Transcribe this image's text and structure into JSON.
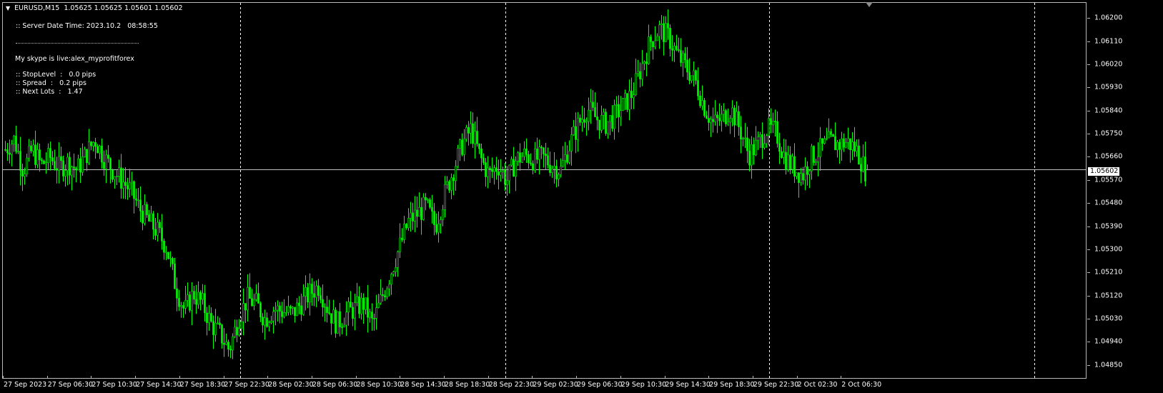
{
  "header": {
    "symbol": "EURUSD,M15",
    "ohlc": "1.05625 1.05625 1.05601 1.05602"
  },
  "info": {
    "server_time": ":: Server Date Time: 2023.10.2   08:58:55",
    "skype": "My skype is live:alex_myprofitforex",
    "stop_level": ":: StopLevel  :   0.0 pips",
    "spread": ":: Spread  :   0.2 pips",
    "next_lots": ":: Next Lots  :   1.47"
  },
  "colors": {
    "background": "#000000",
    "candles": "#00ff00",
    "grid": "#ffffff",
    "bid_line": "#c0c0c0"
  },
  "current_price": "1.05602",
  "chart_data": {
    "type": "candlestick",
    "symbol": "EURUSD",
    "timeframe": "M15",
    "ylim": [
      1.0481,
      1.0624
    ],
    "price_ticks": [
      "1.06200",
      "1.06110",
      "1.06020",
      "1.05930",
      "1.05840",
      "1.05750",
      "1.05660",
      "1.05570",
      "1.05480",
      "1.05390",
      "1.05300",
      "1.05210",
      "1.05120",
      "1.05030",
      "1.04940",
      "1.04850"
    ],
    "time_ticks": [
      "27 Sep 2023",
      "27 Sep 06:30",
      "27 Sep 10:30",
      "27 Sep 14:30",
      "27 Sep 18:30",
      "27 Sep 22:30",
      "28 Sep 02:30",
      "28 Sep 06:30",
      "28 Sep 10:30",
      "28 Sep 14:30",
      "28 Sep 18:30",
      "28 Sep 22:30",
      "29 Sep 02:30",
      "29 Sep 06:30",
      "29 Sep 10:30",
      "29 Sep 14:30",
      "29 Sep 18:30",
      "29 Sep 22:30",
      "2 Oct 02:30",
      "2 Oct 06:30"
    ],
    "period_separators": [
      "27 Sep 23:00",
      "28 Sep 23:00",
      "29 Sep 23:00",
      "2 Oct 23:00"
    ],
    "last_price": 1.05602,
    "price_path": [
      1.0568,
      1.0572,
      1.056,
      1.0568,
      1.0562,
      1.0565,
      1.0561,
      1.0563,
      1.056,
      1.0566,
      1.0572,
      1.0565,
      1.056,
      1.0556,
      1.0552,
      1.0545,
      1.054,
      1.0536,
      1.053,
      1.0515,
      1.0505,
      1.0512,
      1.0508,
      1.05,
      1.0496,
      1.049,
      1.0502,
      1.051,
      1.0508,
      1.0502,
      1.0506,
      1.0505,
      1.0504,
      1.0508,
      1.0512,
      1.0515,
      1.0506,
      1.05,
      1.0504,
      1.0506,
      1.0508,
      1.05,
      1.051,
      1.052,
      1.053,
      1.054,
      1.0543,
      1.0546,
      1.0538,
      1.055,
      1.056,
      1.057,
      1.0576,
      1.0565,
      1.0558,
      1.0562,
      1.0556,
      1.0564,
      1.0566,
      1.0564,
      1.0565,
      1.0562,
      1.056,
      1.057,
      1.0578,
      1.0584,
      1.058,
      1.0578,
      1.0581,
      1.0585,
      1.059,
      1.06,
      1.061,
      1.0615,
      1.0612,
      1.0605,
      1.06,
      1.0595,
      1.0585,
      1.0578,
      1.058,
      1.0584,
      1.0576,
      1.0566,
      1.057,
      1.0576,
      1.0575,
      1.0565,
      1.0561,
      1.0558,
      1.0565,
      1.0568,
      1.0571,
      1.057,
      1.0571,
      1.0568,
      1.056
    ]
  }
}
